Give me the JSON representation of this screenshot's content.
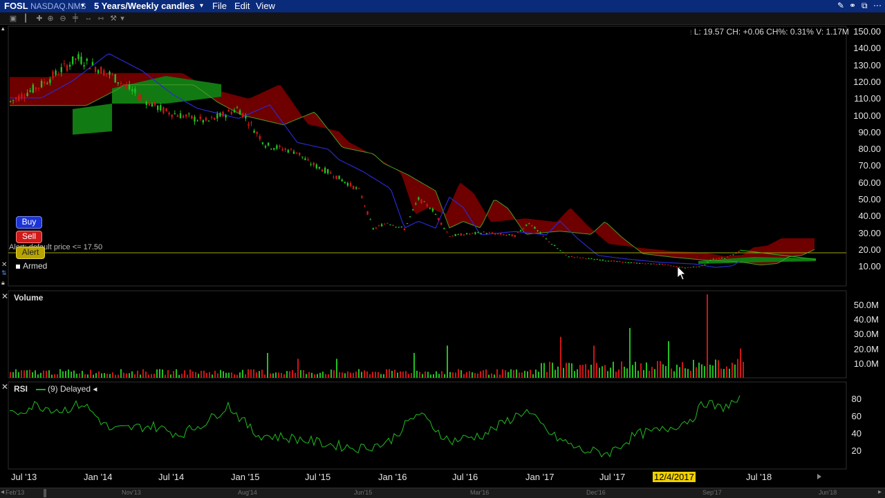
{
  "header": {
    "symbol": "FOSL",
    "exchange": "NASDAQ.NMS",
    "exchange_arrow": "▾",
    "period": "5 Years/Weekly candles",
    "period_arrow": "▾",
    "menu": [
      "File",
      "Edit",
      "View"
    ]
  },
  "info_line": "L: 19.57 CH: +0.06 CH%: 0.31% V: 1.17M",
  "order_panel": {
    "buy_label": "Buy",
    "sell_label": "Sell",
    "alert_label": "Alert",
    "alert_text": "Alert: default price <= 17.50",
    "armed_label": "Armed"
  },
  "price_axis": [
    "150.00",
    "140.00",
    "130.00",
    "120.00",
    "110.00",
    "100.00",
    "90.00",
    "80.00",
    "70.00",
    "60.00",
    "50.00",
    "40.00",
    "30.00",
    "20.00",
    "10.00"
  ],
  "volume_panel": {
    "title": "Volume",
    "axis": [
      "50.0M",
      "40.0M",
      "30.0M",
      "20.0M",
      "10.0M"
    ]
  },
  "rsi_panel": {
    "title": "RSI",
    "legend": "(9) Delayed",
    "legend_arrow": "◂",
    "axis": [
      "80",
      "60",
      "40",
      "20"
    ]
  },
  "x_axis": [
    "Jul '13",
    "Jan '14",
    "Jul '14",
    "Jan '15",
    "Jul '15",
    "Jan '16",
    "Jul '16",
    "Jan '17",
    "Jul '17",
    "12/4/2017",
    "Jul '18"
  ],
  "scroll_axis": [
    "Feb'13",
    "Nov'13",
    "Aug'14",
    "Jun'15",
    "Mar'16",
    "Dec'16",
    "Sep'17",
    "Jun'18"
  ],
  "colors": {
    "up": "#22c122",
    "down": "#d01515",
    "cloud_bear": "#7a0000",
    "cloud_bull": "#127a12",
    "ma": "#2a2ad0",
    "rsi": "#1fae1f",
    "alert_line": "#a8a800",
    "titlebar": "#0a2a7a"
  },
  "icons": [
    "pencil-icon",
    "link-icon",
    "detach-icon",
    "chart-type-icon",
    "bar-icon",
    "crosshair-icon",
    "zoom-in-icon",
    "zoom-out-icon",
    "pan-icon",
    "fit-icon",
    "tools-icon"
  ]
}
